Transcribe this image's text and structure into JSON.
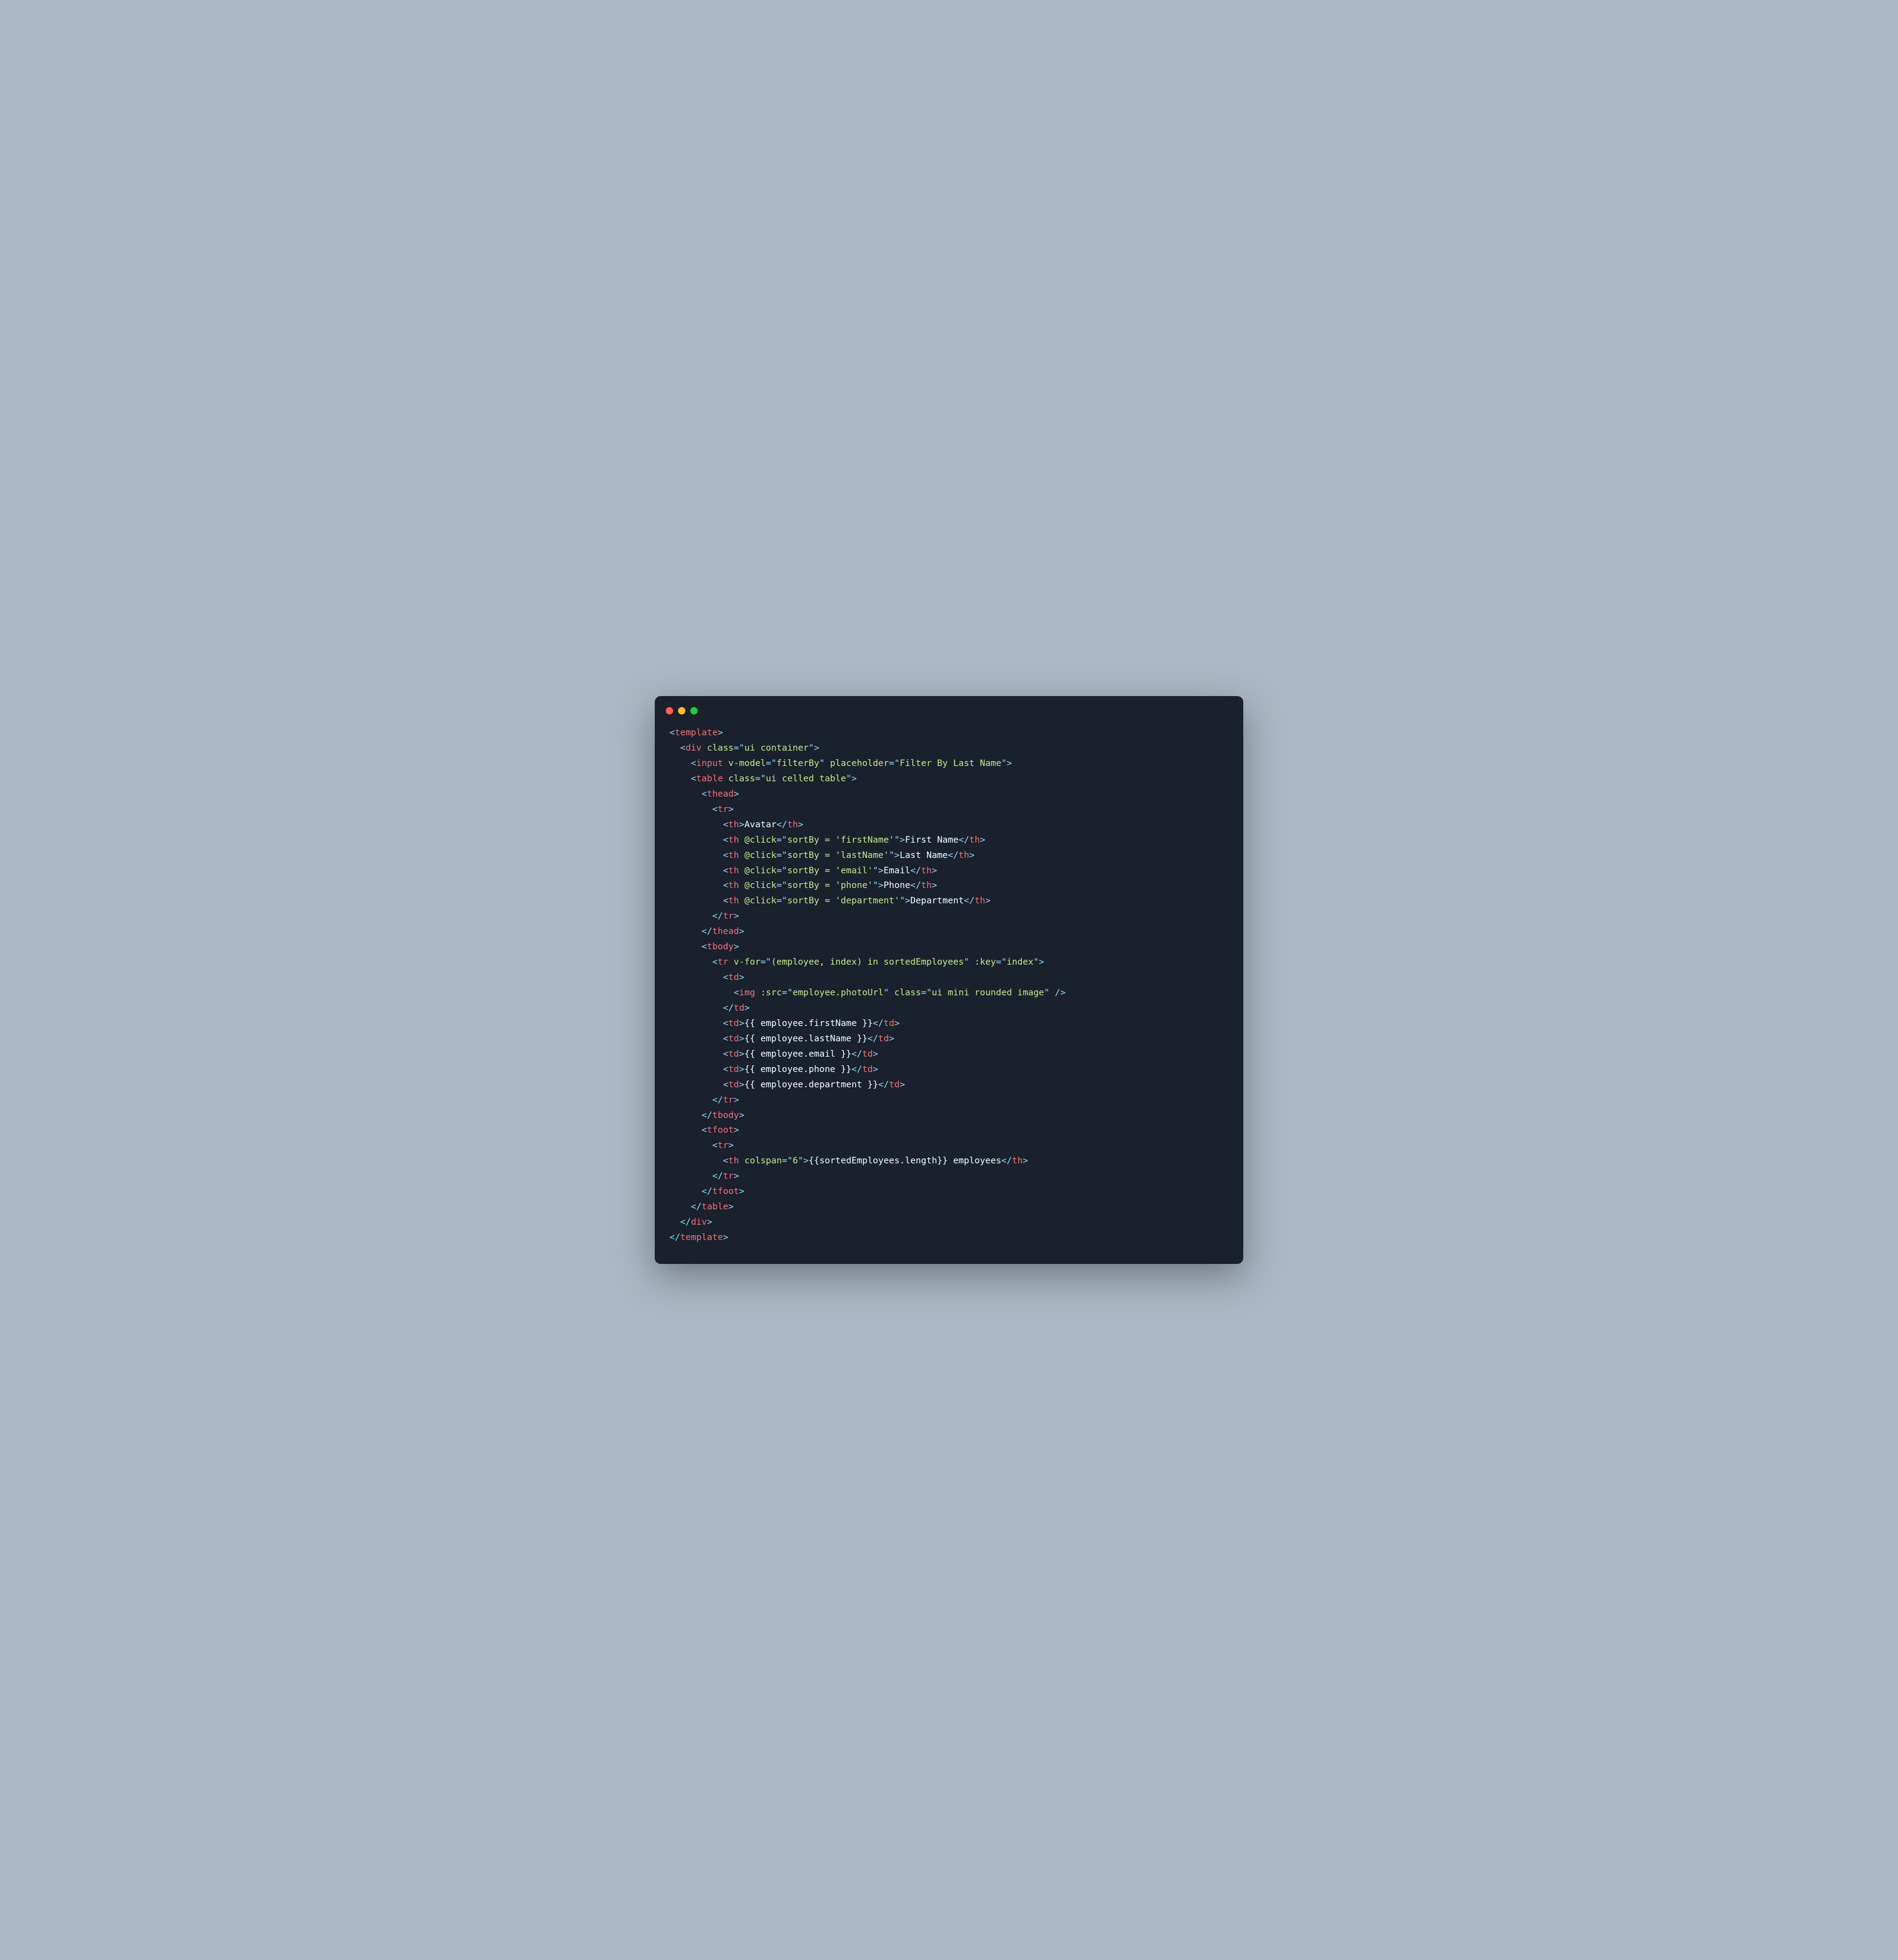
{
  "tokens": [
    [
      [
        "p",
        "<"
      ],
      [
        "tg",
        "template"
      ],
      [
        "p",
        ">"
      ]
    ],
    [
      [
        "tx",
        "  "
      ],
      [
        "p",
        "<"
      ],
      [
        "tg",
        "div"
      ],
      [
        "tx",
        " "
      ],
      [
        "at",
        "class"
      ],
      [
        "eq",
        "="
      ],
      [
        "p",
        "\""
      ],
      [
        "st",
        "ui container"
      ],
      [
        "p",
        "\""
      ],
      [
        "p",
        ">"
      ]
    ],
    [
      [
        "tx",
        "    "
      ],
      [
        "p",
        "<"
      ],
      [
        "tg",
        "input"
      ],
      [
        "tx",
        " "
      ],
      [
        "at",
        "v-model"
      ],
      [
        "eq",
        "="
      ],
      [
        "p",
        "\""
      ],
      [
        "st",
        "filterBy"
      ],
      [
        "p",
        "\""
      ],
      [
        "tx",
        " "
      ],
      [
        "at",
        "placeholder"
      ],
      [
        "eq",
        "="
      ],
      [
        "p",
        "\""
      ],
      [
        "st",
        "Filter By Last Name"
      ],
      [
        "p",
        "\""
      ],
      [
        "p",
        ">"
      ]
    ],
    [
      [
        "tx",
        "    "
      ],
      [
        "p",
        "<"
      ],
      [
        "tg",
        "table"
      ],
      [
        "tx",
        " "
      ],
      [
        "at",
        "class"
      ],
      [
        "eq",
        "="
      ],
      [
        "p",
        "\""
      ],
      [
        "st",
        "ui celled table"
      ],
      [
        "p",
        "\""
      ],
      [
        "p",
        ">"
      ]
    ],
    [
      [
        "tx",
        "      "
      ],
      [
        "p",
        "<"
      ],
      [
        "tg",
        "thead"
      ],
      [
        "p",
        ">"
      ]
    ],
    [
      [
        "tx",
        "        "
      ],
      [
        "p",
        "<"
      ],
      [
        "tg",
        "tr"
      ],
      [
        "p",
        ">"
      ]
    ],
    [
      [
        "tx",
        "          "
      ],
      [
        "p",
        "<"
      ],
      [
        "tg",
        "th"
      ],
      [
        "p",
        ">"
      ],
      [
        "tx",
        "Avatar"
      ],
      [
        "p",
        "</"
      ],
      [
        "tg",
        "th"
      ],
      [
        "p",
        ">"
      ]
    ],
    [
      [
        "tx",
        "          "
      ],
      [
        "p",
        "<"
      ],
      [
        "tg",
        "th"
      ],
      [
        "tx",
        " "
      ],
      [
        "at",
        "@click"
      ],
      [
        "eq",
        "="
      ],
      [
        "p",
        "\""
      ],
      [
        "st",
        "sortBy = 'firstName'"
      ],
      [
        "p",
        "\""
      ],
      [
        "p",
        ">"
      ],
      [
        "tx",
        "First Name"
      ],
      [
        "p",
        "</"
      ],
      [
        "tg",
        "th"
      ],
      [
        "p",
        ">"
      ]
    ],
    [
      [
        "tx",
        "          "
      ],
      [
        "p",
        "<"
      ],
      [
        "tg",
        "th"
      ],
      [
        "tx",
        " "
      ],
      [
        "at",
        "@click"
      ],
      [
        "eq",
        "="
      ],
      [
        "p",
        "\""
      ],
      [
        "st",
        "sortBy = 'lastName'"
      ],
      [
        "p",
        "\""
      ],
      [
        "p",
        ">"
      ],
      [
        "tx",
        "Last Name"
      ],
      [
        "p",
        "</"
      ],
      [
        "tg",
        "th"
      ],
      [
        "p",
        ">"
      ]
    ],
    [
      [
        "tx",
        "          "
      ],
      [
        "p",
        "<"
      ],
      [
        "tg",
        "th"
      ],
      [
        "tx",
        " "
      ],
      [
        "at",
        "@click"
      ],
      [
        "eq",
        "="
      ],
      [
        "p",
        "\""
      ],
      [
        "st",
        "sortBy = 'email'"
      ],
      [
        "p",
        "\""
      ],
      [
        "p",
        ">"
      ],
      [
        "tx",
        "Email"
      ],
      [
        "p",
        "</"
      ],
      [
        "tg",
        "th"
      ],
      [
        "p",
        ">"
      ]
    ],
    [
      [
        "tx",
        "          "
      ],
      [
        "p",
        "<"
      ],
      [
        "tg",
        "th"
      ],
      [
        "tx",
        " "
      ],
      [
        "at",
        "@click"
      ],
      [
        "eq",
        "="
      ],
      [
        "p",
        "\""
      ],
      [
        "st",
        "sortBy = 'phone'"
      ],
      [
        "p",
        "\""
      ],
      [
        "p",
        ">"
      ],
      [
        "tx",
        "Phone"
      ],
      [
        "p",
        "</"
      ],
      [
        "tg",
        "th"
      ],
      [
        "p",
        ">"
      ]
    ],
    [
      [
        "tx",
        "          "
      ],
      [
        "p",
        "<"
      ],
      [
        "tg",
        "th"
      ],
      [
        "tx",
        " "
      ],
      [
        "at",
        "@click"
      ],
      [
        "eq",
        "="
      ],
      [
        "p",
        "\""
      ],
      [
        "st",
        "sortBy = 'department'"
      ],
      [
        "p",
        "\""
      ],
      [
        "p",
        ">"
      ],
      [
        "tx",
        "Department"
      ],
      [
        "p",
        "</"
      ],
      [
        "tg",
        "th"
      ],
      [
        "p",
        ">"
      ]
    ],
    [
      [
        "tx",
        "        "
      ],
      [
        "p",
        "</"
      ],
      [
        "tg",
        "tr"
      ],
      [
        "p",
        ">"
      ]
    ],
    [
      [
        "tx",
        "      "
      ],
      [
        "p",
        "</"
      ],
      [
        "tg",
        "thead"
      ],
      [
        "p",
        ">"
      ]
    ],
    [
      [
        "tx",
        "      "
      ],
      [
        "p",
        "<"
      ],
      [
        "tg",
        "tbody"
      ],
      [
        "p",
        ">"
      ]
    ],
    [
      [
        "tx",
        "        "
      ],
      [
        "p",
        "<"
      ],
      [
        "tg",
        "tr"
      ],
      [
        "tx",
        " "
      ],
      [
        "at",
        "v-for"
      ],
      [
        "eq",
        "="
      ],
      [
        "p",
        "\""
      ],
      [
        "st",
        "(employee, index) in sortedEmployees"
      ],
      [
        "p",
        "\""
      ],
      [
        "tx",
        " "
      ],
      [
        "at",
        ":key"
      ],
      [
        "eq",
        "="
      ],
      [
        "p",
        "\""
      ],
      [
        "st",
        "index"
      ],
      [
        "p",
        "\""
      ],
      [
        "p",
        ">"
      ]
    ],
    [
      [
        "tx",
        "          "
      ],
      [
        "p",
        "<"
      ],
      [
        "tg",
        "td"
      ],
      [
        "p",
        ">"
      ]
    ],
    [
      [
        "tx",
        "            "
      ],
      [
        "p",
        "<"
      ],
      [
        "tg",
        "img"
      ],
      [
        "tx",
        " "
      ],
      [
        "at",
        ":src"
      ],
      [
        "eq",
        "="
      ],
      [
        "p",
        "\""
      ],
      [
        "st",
        "employee.photoUrl"
      ],
      [
        "p",
        "\""
      ],
      [
        "tx",
        " "
      ],
      [
        "at",
        "class"
      ],
      [
        "eq",
        "="
      ],
      [
        "p",
        "\""
      ],
      [
        "st",
        "ui mini rounded image"
      ],
      [
        "p",
        "\""
      ],
      [
        "tx",
        " "
      ],
      [
        "p",
        "/>"
      ]
    ],
    [
      [
        "tx",
        "          "
      ],
      [
        "p",
        "</"
      ],
      [
        "tg",
        "td"
      ],
      [
        "p",
        ">"
      ]
    ],
    [
      [
        "tx",
        "          "
      ],
      [
        "p",
        "<"
      ],
      [
        "tg",
        "td"
      ],
      [
        "p",
        ">"
      ],
      [
        "tx",
        "{{ employee.firstName }}"
      ],
      [
        "p",
        "</"
      ],
      [
        "tg",
        "td"
      ],
      [
        "p",
        ">"
      ]
    ],
    [
      [
        "tx",
        "          "
      ],
      [
        "p",
        "<"
      ],
      [
        "tg",
        "td"
      ],
      [
        "p",
        ">"
      ],
      [
        "tx",
        "{{ employee.lastName }}"
      ],
      [
        "p",
        "</"
      ],
      [
        "tg",
        "td"
      ],
      [
        "p",
        ">"
      ]
    ],
    [
      [
        "tx",
        "          "
      ],
      [
        "p",
        "<"
      ],
      [
        "tg",
        "td"
      ],
      [
        "p",
        ">"
      ],
      [
        "tx",
        "{{ employee.email }}"
      ],
      [
        "p",
        "</"
      ],
      [
        "tg",
        "td"
      ],
      [
        "p",
        ">"
      ]
    ],
    [
      [
        "tx",
        "          "
      ],
      [
        "p",
        "<"
      ],
      [
        "tg",
        "td"
      ],
      [
        "p",
        ">"
      ],
      [
        "tx",
        "{{ employee.phone }}"
      ],
      [
        "p",
        "</"
      ],
      [
        "tg",
        "td"
      ],
      [
        "p",
        ">"
      ]
    ],
    [
      [
        "tx",
        "          "
      ],
      [
        "p",
        "<"
      ],
      [
        "tg",
        "td"
      ],
      [
        "p",
        ">"
      ],
      [
        "tx",
        "{{ employee.department }}"
      ],
      [
        "p",
        "</"
      ],
      [
        "tg",
        "td"
      ],
      [
        "p",
        ">"
      ]
    ],
    [
      [
        "tx",
        "        "
      ],
      [
        "p",
        "</"
      ],
      [
        "tg",
        "tr"
      ],
      [
        "p",
        ">"
      ]
    ],
    [
      [
        "tx",
        "      "
      ],
      [
        "p",
        "</"
      ],
      [
        "tg",
        "tbody"
      ],
      [
        "p",
        ">"
      ]
    ],
    [
      [
        "tx",
        "      "
      ],
      [
        "p",
        "<"
      ],
      [
        "tg",
        "tfoot"
      ],
      [
        "p",
        ">"
      ]
    ],
    [
      [
        "tx",
        "        "
      ],
      [
        "p",
        "<"
      ],
      [
        "tg",
        "tr"
      ],
      [
        "p",
        ">"
      ]
    ],
    [
      [
        "tx",
        "          "
      ],
      [
        "p",
        "<"
      ],
      [
        "tg",
        "th"
      ],
      [
        "tx",
        " "
      ],
      [
        "at",
        "colspan"
      ],
      [
        "eq",
        "="
      ],
      [
        "p",
        "\""
      ],
      [
        "st",
        "6"
      ],
      [
        "p",
        "\""
      ],
      [
        "p",
        ">"
      ],
      [
        "tx",
        "{{sortedEmployees.length}} employees"
      ],
      [
        "p",
        "</"
      ],
      [
        "tg",
        "th"
      ],
      [
        "p",
        ">"
      ]
    ],
    [
      [
        "tx",
        "        "
      ],
      [
        "p",
        "</"
      ],
      [
        "tg",
        "tr"
      ],
      [
        "p",
        ">"
      ]
    ],
    [
      [
        "tx",
        "      "
      ],
      [
        "p",
        "</"
      ],
      [
        "tg",
        "tfoot"
      ],
      [
        "p",
        ">"
      ]
    ],
    [
      [
        "tx",
        "    "
      ],
      [
        "p",
        "</"
      ],
      [
        "tg",
        "table"
      ],
      [
        "p",
        ">"
      ]
    ],
    [
      [
        "tx",
        "  "
      ],
      [
        "p",
        "</"
      ],
      [
        "tg",
        "div"
      ],
      [
        "p",
        ">"
      ]
    ],
    [
      [
        "p",
        "</"
      ],
      [
        "tg",
        "template"
      ],
      [
        "p",
        ">"
      ]
    ]
  ]
}
